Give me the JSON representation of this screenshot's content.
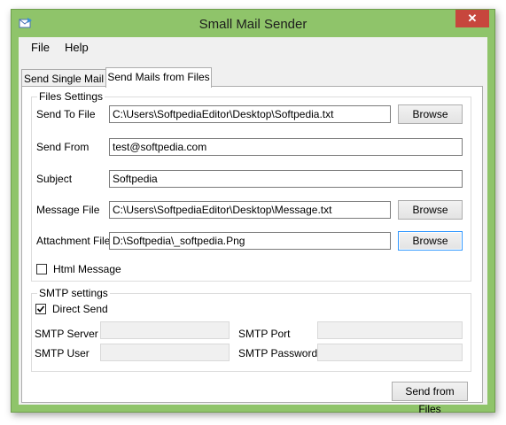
{
  "window": {
    "title": "Small Mail Sender",
    "close_glyph": "✕"
  },
  "menu": {
    "items": [
      "File",
      "Help"
    ]
  },
  "tabs": [
    {
      "label": "Send Single Mail",
      "active": false
    },
    {
      "label": "Send Mails from Files",
      "active": true
    }
  ],
  "files_settings": {
    "legend": "Files Settings",
    "send_to": {
      "label": "Send To File",
      "value": "C:\\Users\\SoftpediaEditor\\Desktop\\Softpedia.txt",
      "browse": "Browse"
    },
    "send_from": {
      "label": "Send From",
      "value": "test@softpedia.com"
    },
    "subject": {
      "label": "Subject",
      "value": "Softpedia"
    },
    "message_file": {
      "label": "Message File",
      "value": "C:\\Users\\SoftpediaEditor\\Desktop\\Message.txt",
      "browse": "Browse"
    },
    "attachment_file": {
      "label": "Attachment File",
      "value": "D:\\Softpedia\\_softpedia.Png",
      "browse": "Browse"
    },
    "html_message": {
      "label": "Html Message",
      "checked": false
    }
  },
  "smtp_settings": {
    "legend": "SMTP settings",
    "direct_send": {
      "label": "Direct Send",
      "checked": true
    },
    "server": {
      "label": "SMTP Server",
      "value": ""
    },
    "port": {
      "label": "SMTP Port",
      "value": ""
    },
    "user": {
      "label": "SMTP User",
      "value": ""
    },
    "password": {
      "label": "SMTP Password",
      "value": ""
    }
  },
  "actions": {
    "send_label": "Send from Files"
  },
  "colors": {
    "frame": "#8fc46a",
    "close": "#c7463d",
    "focus": "#3399ff"
  }
}
